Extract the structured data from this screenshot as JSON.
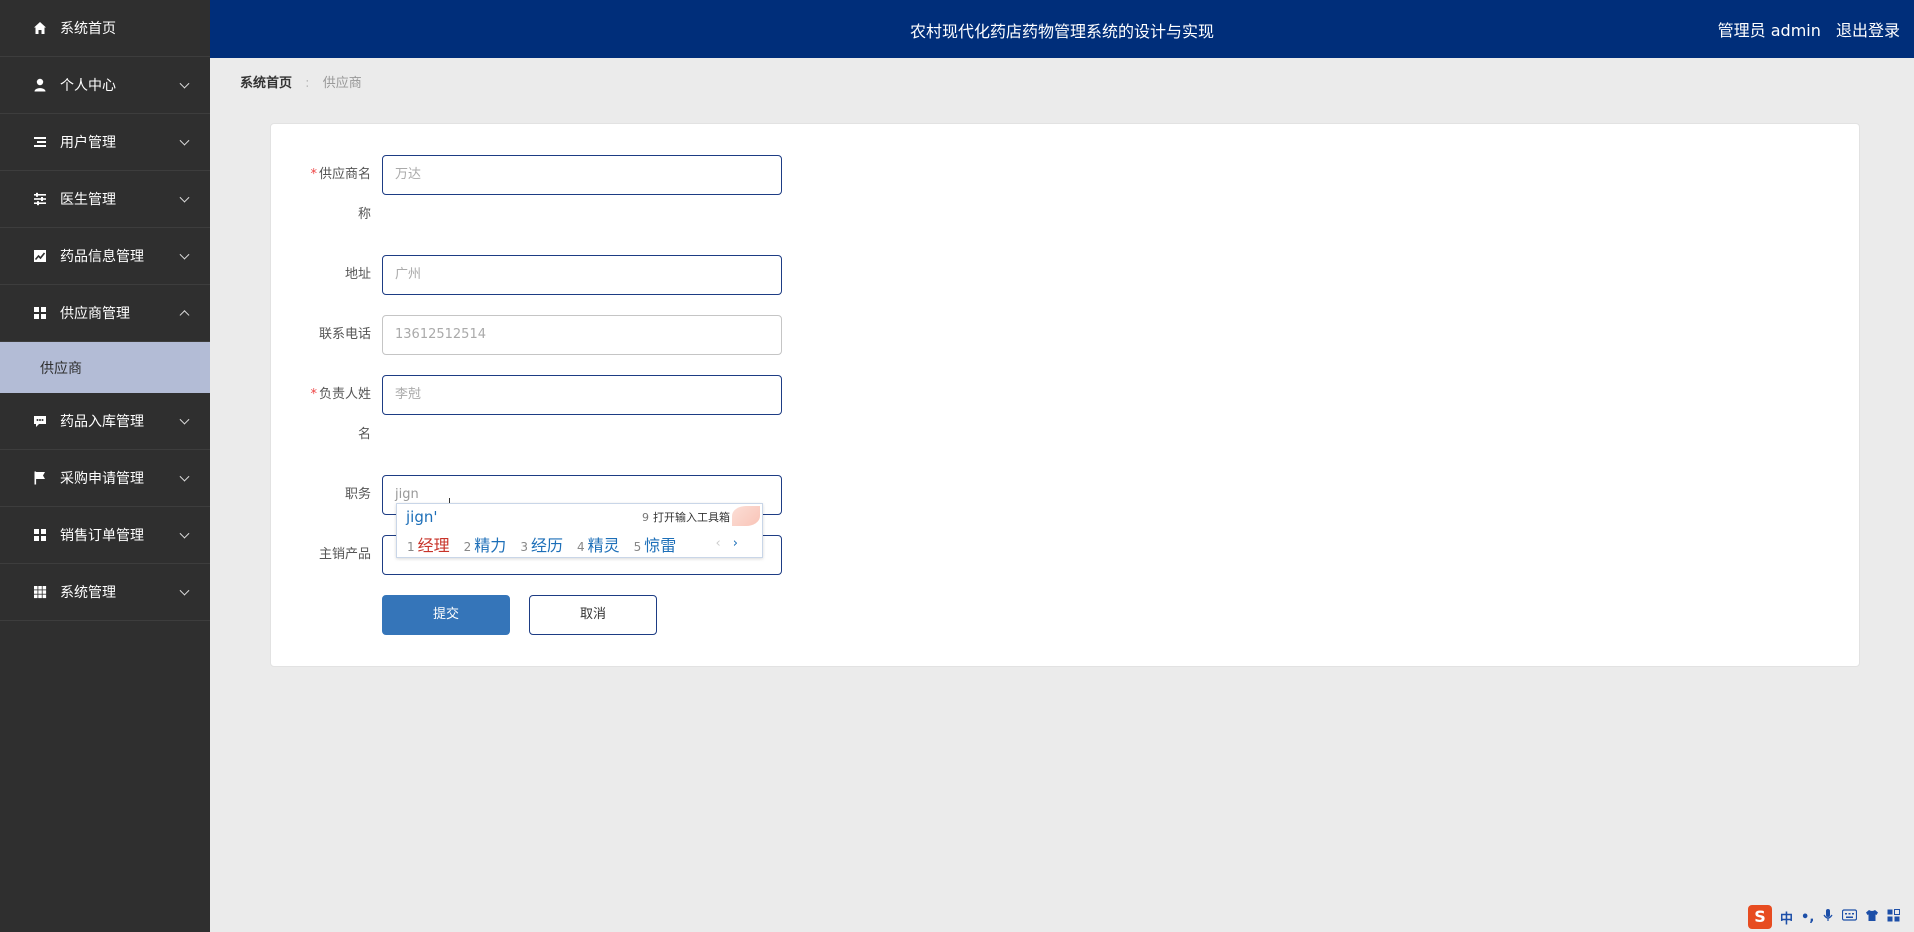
{
  "app": {
    "title": "农村现代化药店药物管理系统的设计与实现",
    "user_label": "管理员 admin",
    "logout": "退出登录"
  },
  "sidebar": {
    "items": [
      {
        "label": "系统首页",
        "icon": "home-icon"
      },
      {
        "label": "个人中心",
        "icon": "user-icon"
      },
      {
        "label": "用户管理",
        "icon": "list-icon"
      },
      {
        "label": "医生管理",
        "icon": "sliders-icon"
      },
      {
        "label": "药品信息管理",
        "icon": "chart-icon"
      },
      {
        "label": "供应商管理",
        "icon": "grid-icon",
        "expanded": true
      },
      {
        "label": "药品入库管理",
        "icon": "chat-icon"
      },
      {
        "label": "采购申请管理",
        "icon": "flag-icon"
      },
      {
        "label": "销售订单管理",
        "icon": "grid-icon"
      },
      {
        "label": "系统管理",
        "icon": "table-icon"
      }
    ],
    "sub_items": [
      {
        "label": "供应商"
      }
    ]
  },
  "breadcrumb": {
    "home": "系统首页",
    "separator": ":",
    "current": "供应商"
  },
  "form": {
    "supplier_name": {
      "label_line1": "供应商名",
      "label_line2": "称",
      "placeholder": "万达",
      "required": true
    },
    "address": {
      "label": "地址",
      "placeholder": "广州"
    },
    "phone": {
      "label": "联系电话",
      "placeholder": "13612512514"
    },
    "contact_name": {
      "label_line1": "负责人姓",
      "label_line2": "名",
      "placeholder": "李尅",
      "required": true
    },
    "position": {
      "label": "职务",
      "value": "jign"
    },
    "main_product": {
      "label": "主销产品",
      "placeholder": ""
    },
    "submit": "提交",
    "cancel": "取消",
    "required_mark": "*"
  },
  "ime": {
    "composition": "jign'",
    "toolbox_num": "9",
    "toolbox_label": "打开输入工具箱",
    "candidates": [
      {
        "n": "1",
        "text": "经理"
      },
      {
        "n": "2",
        "text": "精力"
      },
      {
        "n": "3",
        "text": "经历"
      },
      {
        "n": "4",
        "text": "精灵"
      },
      {
        "n": "5",
        "text": "惊雷"
      }
    ],
    "prev": "‹",
    "next": "›"
  },
  "tray": {
    "logo": "S",
    "lang": "中",
    "punct": "•,"
  },
  "colors": {
    "sidebar_bg": "#2f2f2f",
    "header_bg": "#002e7a",
    "active_sub_bg": "#b3bcd6",
    "primary": "#3575b9",
    "input_border": "#1d3c84"
  }
}
